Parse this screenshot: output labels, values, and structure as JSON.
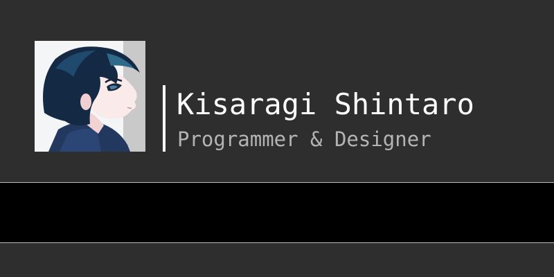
{
  "profile": {
    "name": "Kisaragi Shintaro",
    "role": "Programmer & Designer",
    "avatar_icon": "anime-avatar-icon"
  },
  "colors": {
    "background": "#2e2e2e",
    "band": "#000000",
    "name_text": "#ffffff",
    "role_text": "#b4b4b4",
    "accent_bar": "#ffffff"
  }
}
